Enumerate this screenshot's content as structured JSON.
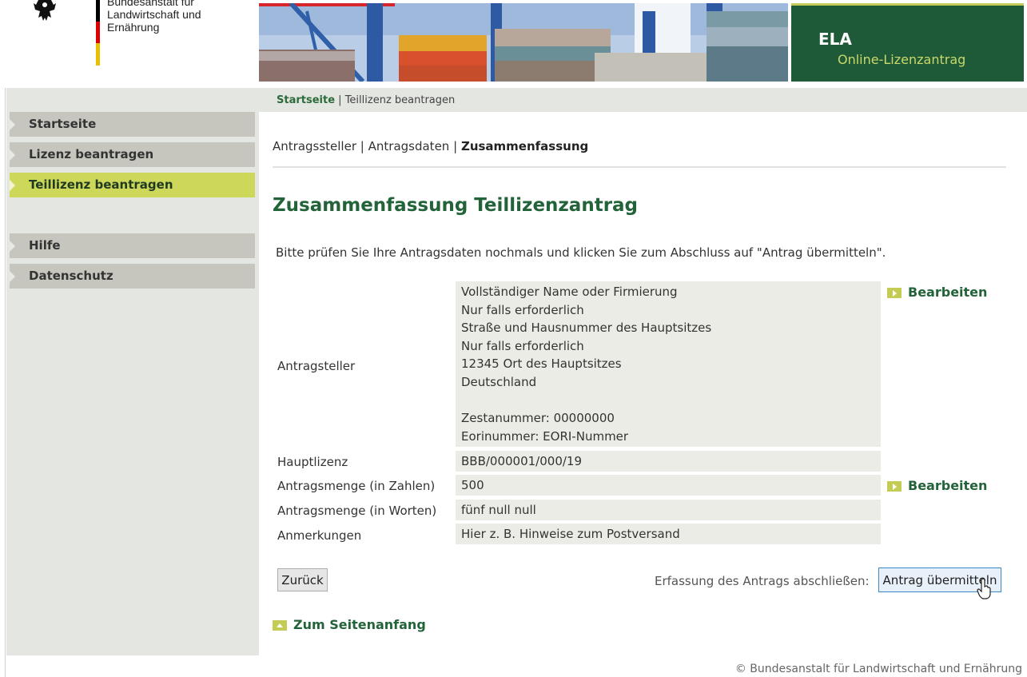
{
  "header": {
    "institution_line1": "Bundesanstalt für",
    "institution_line2": "Landwirtschaft und Ernährung",
    "app_name": "ELA",
    "app_subtitle": "Online-Lizenzantrag"
  },
  "breadcrumb": {
    "home": "Startseite",
    "separator": "|",
    "current": "Teillizenz beantragen"
  },
  "sidebar": {
    "items": [
      {
        "label": "Startseite"
      },
      {
        "label": "Lizenz beantragen"
      },
      {
        "label": "Teillizenz beantragen",
        "active": true
      },
      {
        "label": "Hilfe"
      },
      {
        "label": "Datenschutz"
      }
    ]
  },
  "steps": {
    "step1": "Antragssteller",
    "step2": "Antragsdaten",
    "step3": "Zusammenfassung",
    "separator": "|"
  },
  "main": {
    "title": "Zusammenfassung Teillizenzantrag",
    "intro": "Bitte prüfen Sie Ihre Antragsdaten nochmals und klicken Sie zum Abschluss auf \"Antrag übermitteln\".",
    "applicant": {
      "label": "Antragsteller",
      "lines": [
        "Vollständiger Name oder Firmierung",
        "Nur falls erforderlich",
        "Straße und Hausnummer des Hauptsitzes",
        "Nur falls erforderlich",
        "12345 Ort des Hauptsitzes",
        "Deutschland",
        "",
        "Zestanummer: 00000000",
        "Eorinummer: EORI-Nummer"
      ],
      "edit_label": "Bearbeiten"
    },
    "main_license": {
      "label": "Hauptlizenz",
      "value": "BBB/000001/000/19"
    },
    "quantity_numbers": {
      "label": "Antragsmenge (in Zahlen)",
      "value": "500",
      "edit_label": "Bearbeiten"
    },
    "quantity_words": {
      "label": "Antragsmenge (in Worten)",
      "value": "fünf null null"
    },
    "remarks": {
      "label": "Anmerkungen",
      "value": "Hier z. B. Hinweise zum Postversand"
    },
    "back_button": "Zurück",
    "finish_label": "Erfassung des Antrags abschließen:",
    "submit_button": "Antrag übermitteln",
    "top_link": "Zum Seitenanfang"
  },
  "footer": {
    "copyright": "© Bundesanstalt für Landwirtschaft und Ernährung"
  },
  "colors": {
    "brand_green": "#23633a",
    "header_green": "#1f5a38",
    "accent_yellow": "#cdd75a",
    "nav_gray": "#c6c6bf",
    "panel_gray": "#e4e6e1"
  }
}
